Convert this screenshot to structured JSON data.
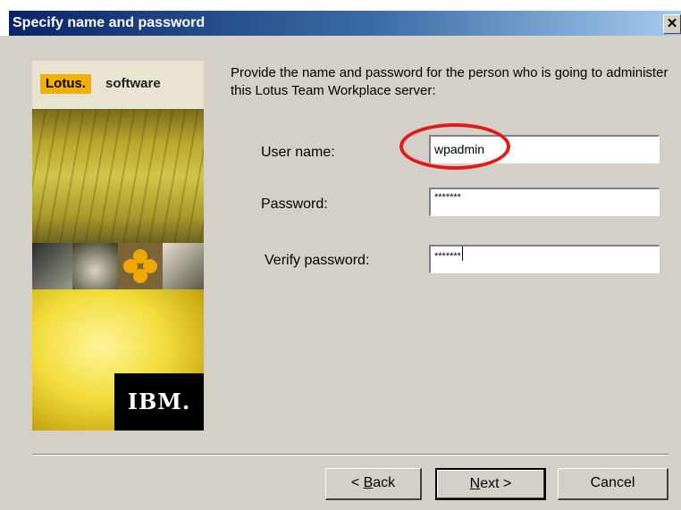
{
  "window": {
    "title": "Specify name and password",
    "close_glyph": "✕"
  },
  "panel": {
    "brand": "Lotus.",
    "product": "software",
    "vendor": "IBM.",
    "icons": [
      "lotus-logo",
      "ibm-logo"
    ]
  },
  "intro": "Provide the name and password for the person who is going to administer this Lotus Team Workplace server:",
  "form": {
    "user_name": {
      "label": "User name:",
      "value": "wpadmin"
    },
    "password": {
      "label": "Password:",
      "value": "*******"
    },
    "verify_password": {
      "label": "Verify password:",
      "value": "*******"
    }
  },
  "buttons": {
    "back": {
      "prefix": "< ",
      "mnemonic": "B",
      "rest": "ack"
    },
    "next": {
      "mnemonic": "N",
      "rest": "ext >"
    },
    "cancel": "Cancel"
  },
  "colors": {
    "title_bar_start": "#0a246a",
    "title_bar_end": "#a6caf0",
    "dialog_bg": "#d4d0c8",
    "highlight": "#e31a1c",
    "lotus_yellow": "#f4b000"
  }
}
